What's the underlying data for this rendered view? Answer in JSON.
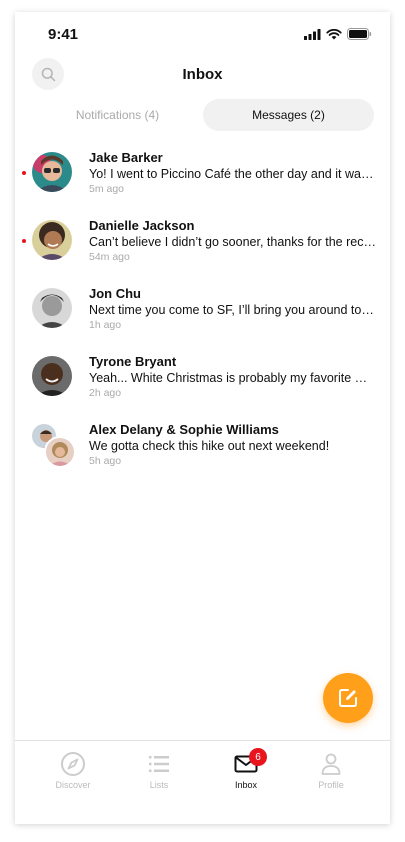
{
  "status_bar": {
    "time": "9:41"
  },
  "header": {
    "title": "Inbox"
  },
  "tabs": [
    {
      "label": "Notifications (4)",
      "active": false
    },
    {
      "label": "Messages (2)",
      "active": true
    }
  ],
  "messages": [
    {
      "name": "Jake Barker",
      "preview": "Yo! I went to Piccino Café the other day and it was amazing",
      "time": "5m ago",
      "unread": true
    },
    {
      "name": "Danielle Jackson",
      "preview": "Can’t believe I didn’t go sooner, thanks for the recommendation",
      "time": "54m ago",
      "unread": true
    },
    {
      "name": "Jon Chu",
      "preview": "Next time you come to SF, I’ll bring you around to my favorite spots",
      "time": "1h ago",
      "unread": false
    },
    {
      "name": "Tyrone Bryant",
      "preview": "Yeah... White Christmas is probably my favorite movie",
      "time": "2h ago",
      "unread": false
    },
    {
      "name": "Alex Delany & Sophie Williams",
      "preview": "We gotta check this hike out next weekend!",
      "time": "5h ago",
      "unread": false
    }
  ],
  "tabbar": {
    "items": [
      {
        "label": "Discover",
        "icon": "compass-icon"
      },
      {
        "label": "Lists",
        "icon": "list-icon"
      },
      {
        "label": "Inbox",
        "icon": "envelope-icon",
        "badge": "6",
        "active": true
      },
      {
        "label": "Profile",
        "icon": "person-icon"
      }
    ]
  },
  "colors": {
    "accent": "#ff9f1a",
    "unread": "#e8141e",
    "badge": "#e8141e"
  }
}
